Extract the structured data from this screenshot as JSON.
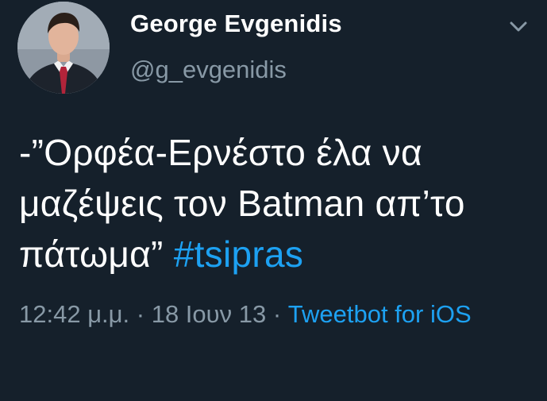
{
  "author": {
    "display_name": "George Evgenidis",
    "handle": "@g_evgenidis",
    "avatar_icon": "profile-photo-man-in-suit"
  },
  "menu": {
    "icon": "chevron-down-icon"
  },
  "tweet": {
    "text_before_hashtag": "-”Ορφέα-Ερνέστο έλα να μαζέψεις τον Batman απ’το πάτωμα” ",
    "hashtag": "#tsipras"
  },
  "meta": {
    "time": "12:42 μ.μ.",
    "separator": " · ",
    "date": "18 Ιουν 13",
    "separator2": " · ",
    "source": "Tweetbot for iOS"
  },
  "colors": {
    "background": "#15202b",
    "text": "#ffffff",
    "secondary_text": "#8899a6",
    "link": "#1da1f2"
  }
}
